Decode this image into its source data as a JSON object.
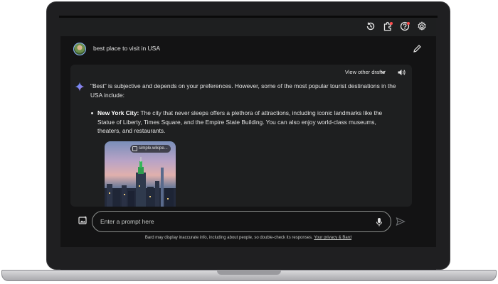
{
  "prompt": {
    "text": "best place to visit in USA"
  },
  "response": {
    "view_drafts_label": "View other drafts",
    "intro": "\"Best\" is subjective and depends on your preferences. However, some of the most popular tourist destinations in the USA include:",
    "items": [
      {
        "title": "New York City:",
        "text": " The city that never sleeps offers a plethora of attractions, including iconic landmarks like the Statue of Liberty, Times Square, and the Empire State Building. You can also enjoy world-class museums, theaters, and restaurants."
      }
    ],
    "image_source": "simple.wikipe..."
  },
  "input": {
    "placeholder": "Enter a prompt here"
  },
  "footer": {
    "disclaimer": "Bard may display inaccurate info, including about people, so double-check its responses.",
    "privacy_link": "Your privacy & Bard"
  },
  "icons": {
    "topbar": [
      "history-icon",
      "extensions-icon",
      "help-icon",
      "settings-icon"
    ],
    "notification_color": "#ff4d4d",
    "accent": "#8cb7ff"
  }
}
